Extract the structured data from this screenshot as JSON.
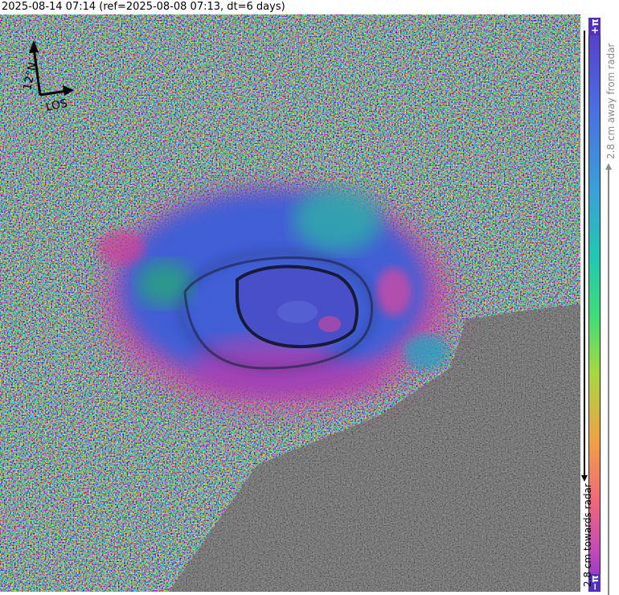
{
  "header": {
    "title": "2025-08-14 07:14 (ref=2025-08-08 07:13, dt=6 days)"
  },
  "compass": {
    "north_label": "12°N",
    "los_label": "LOS"
  },
  "colorbar": {
    "top_end": "+π",
    "bottom_end": "−π",
    "away_label": "2.8 cm away from radar",
    "towards_label": "2.8 cm towards radar",
    "away_color": "#888888",
    "towards_color": "#000000"
  },
  "colors": {
    "accent_violet": "#5a36c4",
    "deformation_blue": "#3a60d8"
  }
}
